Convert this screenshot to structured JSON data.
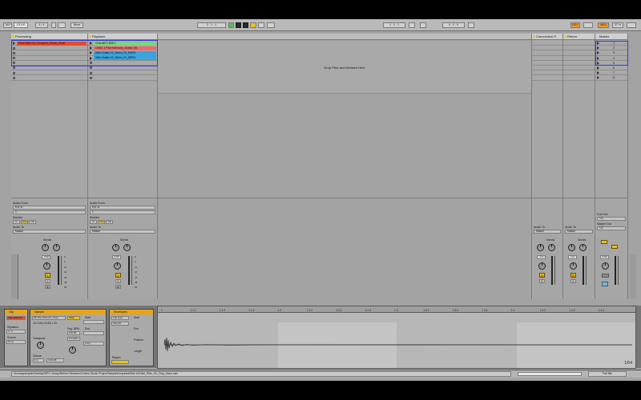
{
  "transport": {
    "tap": "TAP",
    "tempo": "120.00",
    "signature": "4 / 4",
    "metro": "None",
    "position": "2 . 1 . 1",
    "loop_start": "1 . 1 . 1",
    "loop_len": "4 . 0 . 0",
    "key": "KEY",
    "midi": "MIDI",
    "cpu": "37 %"
  },
  "tracks": [
    {
      "name": "Processing",
      "slots": [
        {
          "clip": "Vibe-Ride-Kit_Chopped_Guitar_Rock",
          "color": "#e34c2a"
        },
        {
          "clip": ""
        },
        {
          "clip": ""
        },
        {
          "clip": ""
        },
        {
          "clip": ""
        },
        {
          "clip": ""
        },
        {
          "clip": ""
        },
        {
          "clip": ""
        }
      ],
      "audio_from": "Ext. In",
      "input_ch": "1",
      "audio_to": "Master",
      "vol": "-0.90",
      "arm": "1",
      "monitor": [
        "In",
        "Auto",
        "Off"
      ]
    },
    {
      "name": "Playback",
      "slots": [
        {
          "clip": "ChordsFX 808 1",
          "color": "#7ed37b"
        },
        {
          "clip": "OnM1 1 Pad Harmony_Guitar_86",
          "color": "#ec6a6a"
        },
        {
          "clip": "Vibe Guitar V1_Mono_Dr_80PM",
          "color": "#3aa2dc"
        },
        {
          "clip": "Vibe Guitar V1_Mono_Dr_86PM",
          "color": "#3aa2dc"
        },
        {
          "clip": ""
        },
        {
          "clip": ""
        },
        {
          "clip": ""
        },
        {
          "clip": ""
        }
      ],
      "audio_from": "Ext. In",
      "input_ch": "1",
      "audio_to": "Master",
      "vol": "0.00",
      "arm": "2",
      "monitor": [
        "In",
        "Auto",
        "Off"
      ]
    }
  ],
  "drop_hint": "Drop Files and Devices Here",
  "returns": [
    {
      "name": "Convolution R",
      "audio_to": "Master",
      "vol": "-inf",
      "btn": "A"
    },
    {
      "name": "Return",
      "audio_to": "Master",
      "vol": "-inf",
      "btn": "B"
    }
  ],
  "master": {
    "name": "Master",
    "scenes": [
      "1",
      "2",
      "3",
      "4",
      "5",
      "6",
      "7",
      "8"
    ],
    "cue_out": "Cue Out",
    "cue_val": "1/2",
    "master_out": "Master Out",
    "master_val": "1/2",
    "vol": "0.00"
  },
  "sends_label": "Sends",
  "scale": [
    "0",
    "6",
    "12",
    "24",
    "36",
    "48",
    "60"
  ],
  "labels": {
    "audio_from": "Audio From",
    "audio_to": "Audio To",
    "monitor": "Monitor"
  },
  "detail": {
    "clip_title": "Clip",
    "clip_name": "Vibe-Ride-Kit",
    "signature_label": "Signature",
    "signature": "4 / 4",
    "groove_label": "Groove",
    "groove": "None",
    "sample_title": "Sample",
    "sample_file": "08-Vibe-Ride-Kit_Chop",
    "sample_info": "44.1 kHz 24 Bit 1 Ch",
    "warp": "Warp",
    "seg_bpm": "Seg. BPM",
    "seg_bpm_val": "120.00",
    "transpose": "Transpose",
    "detune": "Detune",
    "detune_val": "0 ct",
    "gain": "0.00 dB",
    "start_label": "Start",
    "end_label": "End",
    "loop": "Loop",
    "complex": "Complex",
    "envelopes_title": "Envelopes",
    "env_region": "Region",
    "clip_env": "Clip Gain",
    "env_val": "Sample",
    "position_label": "Position",
    "length_label": "Length",
    "page_label": "1/64"
  },
  "ruler": [
    "1",
    "1.1.2",
    "1.1.3",
    "1.1.4",
    "1.2",
    "1.2.2",
    "1.2.3",
    "1.2.4",
    "1.3",
    "1.3.2",
    "1.3.3",
    "1.3.4",
    "1.4",
    "1.4.2",
    "1.4.3",
    "1.4.4"
  ],
  "status": {
    "path": "/Users/grandpoh/Desktop/MPV Library/Ableton Sessions/Cinema Studio Project/Samples/Imported/Ride Kit/Vibe_Ride_Kit_Chop_Mono.wav",
    "view": "Pad Mix"
  }
}
